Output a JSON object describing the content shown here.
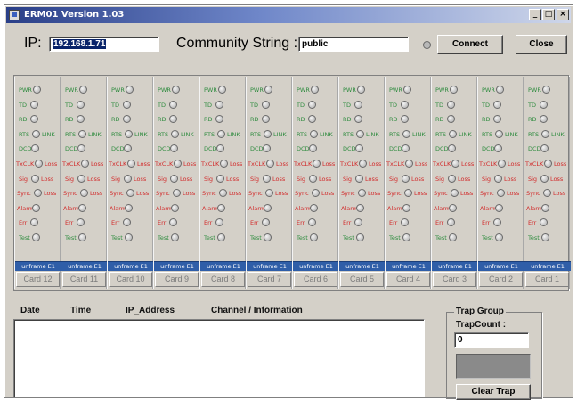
{
  "window": {
    "title": "ERM01  Version  1.03",
    "controls": {
      "minimize": "_",
      "maximize": "□",
      "close": "×"
    }
  },
  "connection": {
    "ip_label": "IP:",
    "ip_value": "192.168.1.71",
    "community_label": "Community String :",
    "community_value": "public",
    "connect_label": "Connect",
    "close_label": "Close",
    "status_led_color": "#b8b8b8"
  },
  "signal_names": {
    "pwr": "PWR",
    "td": "TD",
    "rd": "RD",
    "rts": "RTS",
    "dcd": "DCD",
    "txclk": "TxCLK",
    "sig": "Sig",
    "sync": "Sync",
    "alarm": "Alarm",
    "err": "Err",
    "test": "Test",
    "link": "LINK",
    "loss": "Loss"
  },
  "colors": {
    "green_label": "#2e8b3e",
    "red_label": "#d22a2a",
    "status_bar": "#2f5ea8",
    "led_off": "#b0b0b0"
  },
  "cards": [
    {
      "label": "Card 12",
      "status": "unframe E1"
    },
    {
      "label": "Card 11",
      "status": "unframe E1"
    },
    {
      "label": "Card 10",
      "status": "unframe E1"
    },
    {
      "label": "Card 9",
      "status": "unframe E1"
    },
    {
      "label": "Card 8",
      "status": "unframe E1"
    },
    {
      "label": "Card 7",
      "status": "unframe E1"
    },
    {
      "label": "Card 6",
      "status": "unframe E1"
    },
    {
      "label": "Card 5",
      "status": "unframe E1"
    },
    {
      "label": "Card 4",
      "status": "unframe E1"
    },
    {
      "label": "Card 3",
      "status": "unframe E1"
    },
    {
      "label": "Card 2",
      "status": "unframe E1"
    },
    {
      "label": "Card 1",
      "status": "unframe E1"
    }
  ],
  "log": {
    "columns": [
      "Date",
      "Time",
      "IP_Address",
      "Channel  /  Information"
    ]
  },
  "trap": {
    "group_label": "Trap Group",
    "count_label": "TrapCount :",
    "count_value": "0",
    "clear_label": "Clear Trap"
  }
}
